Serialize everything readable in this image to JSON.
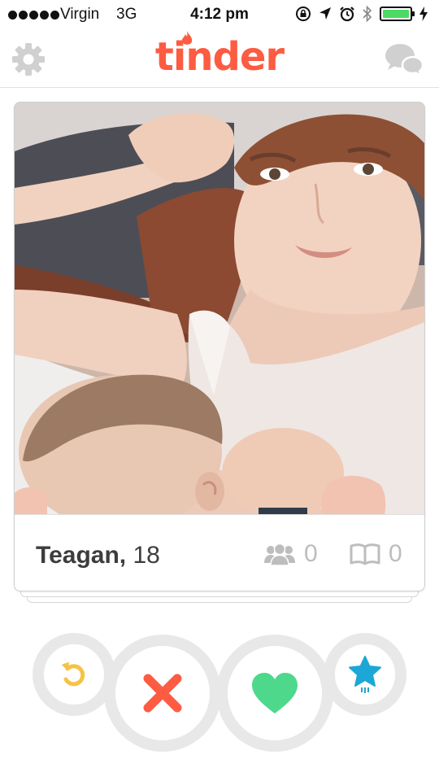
{
  "status_bar": {
    "carrier": "Virgin",
    "network": "3G",
    "time": "4:12 pm",
    "battery_level": 1.0,
    "icons": [
      "rotation-lock-icon",
      "location-arrow-icon",
      "alarm-icon",
      "bluetooth-icon",
      "battery-icon",
      "charging-bolt-icon"
    ]
  },
  "header": {
    "logo_text": "tinder",
    "left_icon": "gear-icon",
    "right_icon": "chat-bubbles-icon"
  },
  "card": {
    "photo": "profile-photo",
    "name": "Teagan,",
    "age": "18",
    "shared_friends_count": "0",
    "shared_interests_count": "0"
  },
  "actions": [
    {
      "name": "undo",
      "icon": "undo-icon",
      "color": "#f5c345"
    },
    {
      "name": "nope",
      "icon": "x-icon",
      "color": "#fd5c42"
    },
    {
      "name": "like",
      "icon": "heart-icon",
      "color": "#4ed88c"
    },
    {
      "name": "super-like",
      "icon": "star-icon",
      "color": "#1da7d6"
    }
  ],
  "colors": {
    "brand": "#fd5c42",
    "icon_gray": "#bdbdbd",
    "button_ring": "#e8e8e8"
  }
}
